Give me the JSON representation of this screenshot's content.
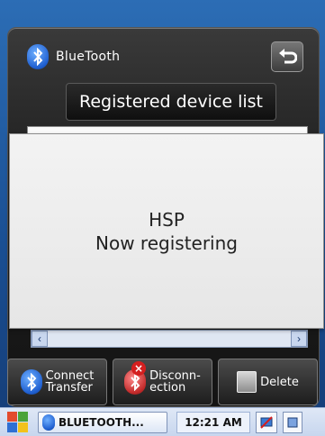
{
  "app": {
    "title": "BlueTooth",
    "icon": "bluetooth-icon",
    "back_icon": "return-arrow-icon",
    "registered_button": "Registered device list"
  },
  "dialog": {
    "line1": "HSP",
    "line2": "Now registering"
  },
  "toolbar": {
    "buttons": [
      {
        "line1": "Connect",
        "line2": "Transfer",
        "icon": "bluetooth-connect-icon"
      },
      {
        "line1": "Disconn-",
        "line2": "ection",
        "icon": "bluetooth-disconnect-icon"
      },
      {
        "line1": "Delete",
        "icon": "trash-icon"
      }
    ]
  },
  "taskbar": {
    "app_label": "BLUETOOTH...",
    "clock": "12:21 AM"
  },
  "colors": {
    "bluetooth": "#1f5fd0",
    "badge_red": "#d41f1f"
  }
}
